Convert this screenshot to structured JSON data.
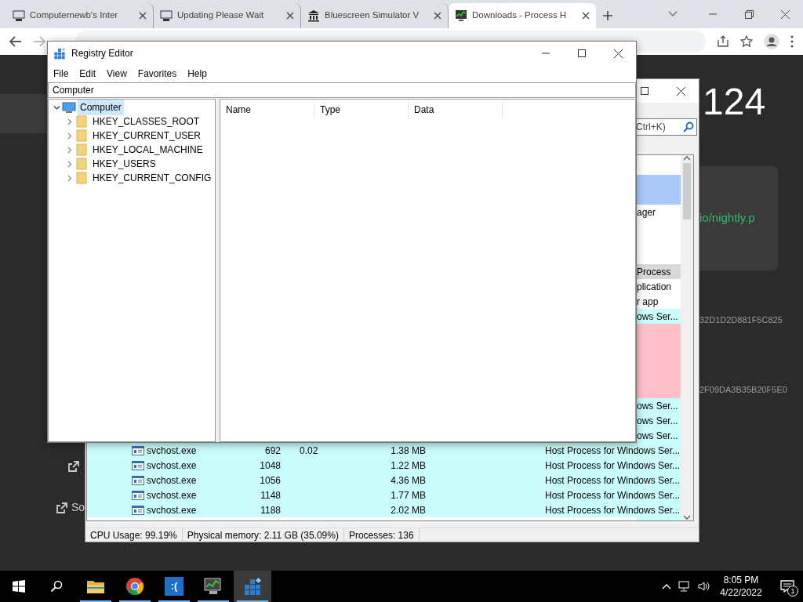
{
  "browser": {
    "tabs": [
      {
        "title": "Computernewb's Inter",
        "kind": "computer",
        "selected": false
      },
      {
        "title": "Updating Please Wait",
        "kind": "computer",
        "selected": false
      },
      {
        "title": "Bluescreen Simulator V",
        "kind": "building",
        "selected": false
      },
      {
        "title": "Downloads - Process H",
        "kind": "monitor",
        "selected": true
      }
    ]
  },
  "web_page": {
    "heading": "124",
    "link": "io/nightly.p",
    "hashes": [
      "32D1D2D881F5C825",
      "2F09DA3B35B20F5E0"
    ],
    "side_link": "So"
  },
  "process_hacker": {
    "search": {
      "placeholder": "Ctrl+K)"
    },
    "rows": [
      {
        "kind": "blank"
      },
      {
        "kind": "clipped",
        "color": "#a9c9f8"
      },
      {
        "kind": "clipped",
        "color": "#a9c9f8"
      },
      {
        "kind": "clipped",
        "color": "#ffffff",
        "description": "ager"
      },
      {
        "kind": "blank"
      },
      {
        "kind": "blank"
      },
      {
        "kind": "blank"
      },
      {
        "kind": "clipped",
        "color": "#d8d8d8",
        "description": "Process"
      },
      {
        "kind": "clipped",
        "color": "#ffffff",
        "description": "plication"
      },
      {
        "kind": "clipped",
        "color": "#ffffff",
        "description": "r app"
      },
      {
        "kind": "clipped",
        "color": "#cafcfc",
        "description": "ows Ser..."
      },
      {
        "kind": "clipped",
        "color": "#ffc0cc"
      },
      {
        "kind": "clipped",
        "color": "#ffc0cc"
      },
      {
        "kind": "clipped",
        "color": "#ffc0cc"
      },
      {
        "kind": "clipped",
        "color": "#ffc0cc"
      },
      {
        "kind": "clipped",
        "color": "#ffc0cc"
      },
      {
        "kind": "clipped",
        "color": "#cafcfc",
        "description": "ows Ser..."
      },
      {
        "kind": "clipped",
        "color": "#cafcfc",
        "description": "ows Ser..."
      },
      {
        "kind": "clipped",
        "color": "#cafcfc",
        "description": "ows Ser..."
      },
      {
        "kind": "process",
        "color": "#cafcfc",
        "name": "svchost.exe",
        "pid": "692",
        "cpu": "0.02",
        "memory": "1.38 MB",
        "description": "Host Process for Windows Ser..."
      },
      {
        "kind": "process",
        "color": "#cafcfc",
        "name": "svchost.exe",
        "pid": "1048",
        "memory": "1.22 MB",
        "description": "Host Process for Windows Ser..."
      },
      {
        "kind": "process",
        "color": "#cafcfc",
        "name": "svchost.exe",
        "pid": "1056",
        "memory": "4.36 MB",
        "description": "Host Process for Windows Ser..."
      },
      {
        "kind": "process",
        "color": "#cafcfc",
        "name": "svchost.exe",
        "pid": "1148",
        "memory": "1.77 MB",
        "description": "Host Process for Windows Ser..."
      },
      {
        "kind": "process",
        "color": "#cafcfc",
        "name": "svchost.exe",
        "pid": "1188",
        "memory": "2.02 MB",
        "description": "Host Process for Windows Ser..."
      },
      {
        "kind": "clipped",
        "color": "#cafcfc"
      }
    ],
    "status_bar": [
      "CPU Usage: 99.19%",
      "Physical memory: 2.11 GB (35.09%)",
      "Processes: 136"
    ]
  },
  "registry_editor": {
    "title": "Registry Editor",
    "menu": [
      "File",
      "Edit",
      "View",
      "Favorites",
      "Help"
    ],
    "address": "Computer",
    "tree": [
      {
        "label": "Computer",
        "expanded": true,
        "selected": true,
        "children": [
          {
            "label": "HKEY_CLASSES_ROOT",
            "expanded": false,
            "selected": false
          },
          {
            "label": "HKEY_CURRENT_USER",
            "expanded": false,
            "selected": false
          },
          {
            "label": "HKEY_LOCAL_MACHINE",
            "expanded": false,
            "selected": false
          },
          {
            "label": "HKEY_USERS",
            "expanded": false,
            "selected": false
          },
          {
            "label": "HKEY_CURRENT_CONFIG",
            "expanded": false,
            "selected": false
          }
        ]
      }
    ],
    "columns": [
      "Name",
      "Type",
      "Data"
    ]
  },
  "taskbar": {
    "apps": [
      {
        "kind": "folder",
        "selected": false
      },
      {
        "kind": "browser",
        "selected": false
      },
      {
        "kind": "tile",
        "glyph": ":(",
        "selected": false
      },
      {
        "kind": "monitor",
        "selected": false
      },
      {
        "kind": "cubes",
        "selected": true
      }
    ],
    "time": "8:05 PM",
    "date": "4/22/2022",
    "notifications": "1"
  }
}
